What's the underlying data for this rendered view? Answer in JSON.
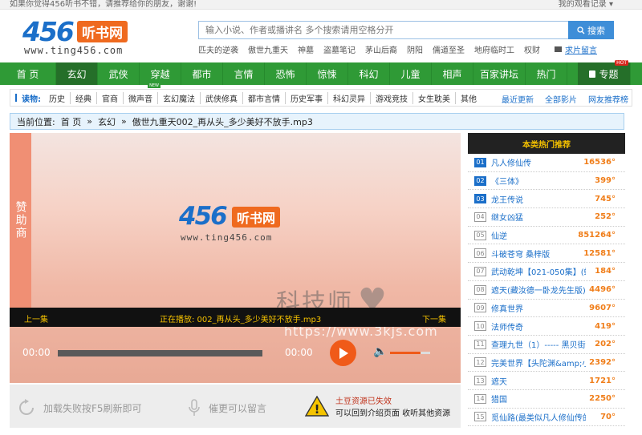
{
  "topbar": {
    "welcome": "如果你觉得456听书不错，请推荐给你的朋友，谢谢!",
    "history": "我的观看记录 ▾"
  },
  "logo": {
    "number": "456",
    "name": "听书网",
    "url": "www.ting456.com"
  },
  "search": {
    "placeholder": "输入小说、作者或播讲名 多个搜索请用空格分开",
    "button": "搜索"
  },
  "hotwords": [
    "匹夫的逆袭",
    "傲世九重天",
    "神墓",
    "盗墓笔记",
    "茅山后裔",
    "阴阳",
    "儒道至圣",
    "地府临时工",
    "权财"
  ],
  "request_link": "求片留言",
  "nav": {
    "items": [
      "首 页",
      "玄幻",
      "武侠",
      "穿越",
      "都市",
      "言情",
      "恐怖",
      "惊悚",
      "科幻",
      "儿童",
      "相声",
      "百家讲坛",
      "热门"
    ],
    "special": "专题",
    "hot_badge": "HOT"
  },
  "subnav": {
    "lead": "读物:",
    "items": [
      "历史",
      "经典",
      "官商",
      "微声音",
      "玄幻魔法",
      "武侠修真",
      "都市言情",
      "历史军事",
      "科幻灵异",
      "游戏竞技",
      "女生耽美",
      "其他"
    ],
    "new_badge": "NEW",
    "right": [
      "最近更新",
      "全部影片",
      "网友推荐榜"
    ]
  },
  "breadcrumb": {
    "label": "当前位置:",
    "home": "首 页",
    "sep": "»",
    "category": "玄幻",
    "current": "傲世九重天002_再从头_多少美好不放手.mp3"
  },
  "player": {
    "sponsor": "赞助商",
    "prev": "上一集",
    "now_playing": "正在播放: 002_再从头_多少美好不放手.mp3",
    "next": "下一集",
    "time_current": "00:00",
    "time_total": "00:00",
    "watermark": "科技师",
    "watermark_url": "https://www.3kjs.com",
    "volume_level": 0.76
  },
  "tips": {
    "reload": "加载失败按F5刷新即可",
    "comment": "催更可以留言",
    "invalid_line1": "土豆资源已失效",
    "invalid_line2": "可以回到介绍页面  收听其他资源"
  },
  "sidebar": {
    "title": "本类热门推荐",
    "items": [
      {
        "rank": "01",
        "title": "凡人修仙传",
        "count": "16536°"
      },
      {
        "rank": "02",
        "title": "《三体》",
        "count": "399°"
      },
      {
        "rank": "03",
        "title": "龙王传说",
        "count": "745°"
      },
      {
        "rank": "04",
        "title": "继女凶猛",
        "count": "252°"
      },
      {
        "rank": "05",
        "title": "仙逆",
        "count": "851264°"
      },
      {
        "rank": "06",
        "title": "斗破苍穹 桑梓版",
        "count": "12581°"
      },
      {
        "rank": "07",
        "title": "武动乾坤【021-050集】(蜡笔",
        "count": "184°"
      },
      {
        "rank": "08",
        "title": "遮天(藏汝德一卧龙先生版)",
        "count": "4496°"
      },
      {
        "rank": "09",
        "title": "修真世界",
        "count": "9607°"
      },
      {
        "rank": "10",
        "title": "法师传奇",
        "count": "419°"
      },
      {
        "rank": "11",
        "title": "查理九世（1）----- 黑贝街的",
        "count": "202°"
      },
      {
        "rank": "12",
        "title": "完美世界【头陀渊&amp;小",
        "count": "2392°"
      },
      {
        "rank": "13",
        "title": "遮天",
        "count": "1721°"
      },
      {
        "rank": "14",
        "title": "猎国",
        "count": "2250°"
      },
      {
        "rank": "15",
        "title": "觅仙路(最类似凡人修仙传的书)",
        "count": "70°"
      }
    ]
  },
  "colors": {
    "green_nav": "#2f9a36",
    "accent_orange": "#f05a19",
    "link_blue": "#1b6fc9"
  }
}
